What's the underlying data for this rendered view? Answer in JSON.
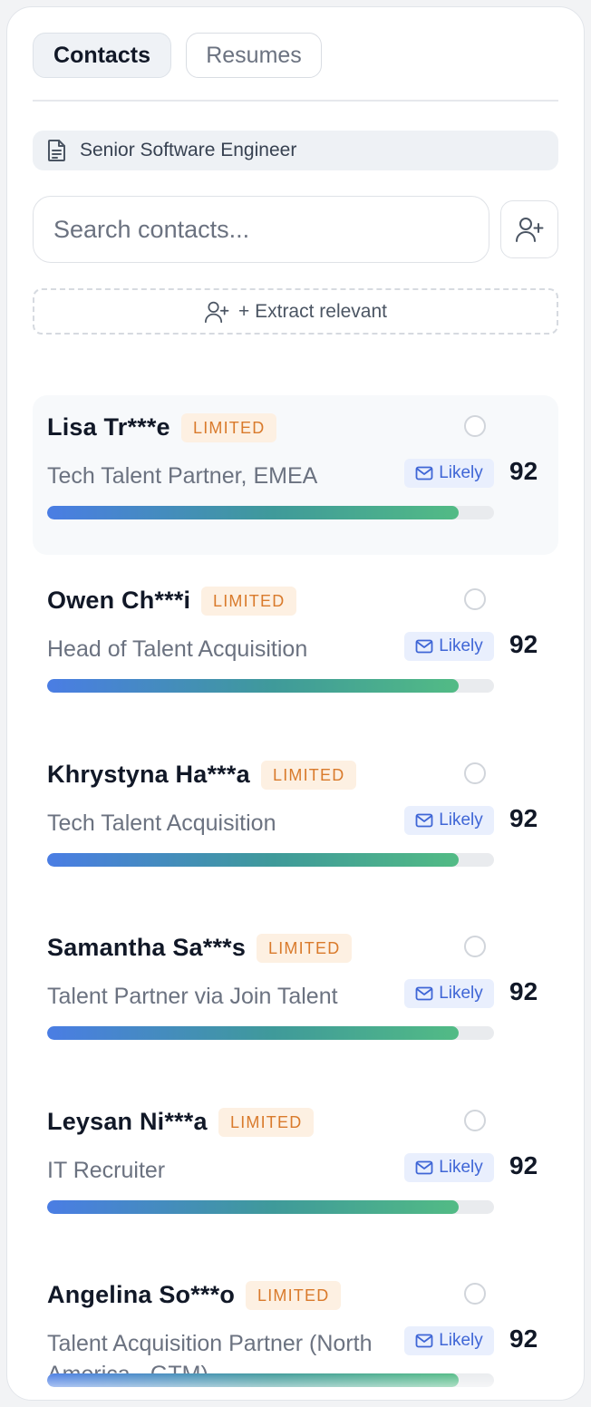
{
  "tabs": {
    "contacts": "Contacts",
    "resumes": "Resumes"
  },
  "job": {
    "title": "Senior Software Engineer",
    "icon": "document-icon"
  },
  "search": {
    "placeholder": "Search contacts..."
  },
  "add_contact_icon": "user-plus-icon",
  "extract": {
    "label": "+ Extract relevant",
    "icon": "user-plus-icon"
  },
  "colors": {
    "badge_text": "#d97a2b",
    "badge_bg": "#fdf0e2",
    "likely_text": "#3f66d6",
    "likely_bg": "#e9effd",
    "bar_start": "#4a7de4",
    "bar_end": "#52bb85"
  },
  "contacts": [
    {
      "name": "Lisa Tr***e",
      "badge": "LIMITED",
      "role": "Tech Talent Partner, EMEA",
      "email_status": "Likely",
      "score": "92",
      "match_fraction": 0.92,
      "highlighted": true
    },
    {
      "name": "Owen Ch***i",
      "badge": "LIMITED",
      "role": "Head of Talent Acquisition",
      "email_status": "Likely",
      "score": "92",
      "match_fraction": 0.92
    },
    {
      "name": "Khrystyna Ha***a",
      "badge": "LIMITED",
      "role": "Tech Talent Acquisition",
      "email_status": "Likely",
      "score": "92",
      "match_fraction": 0.92
    },
    {
      "name": "Samantha Sa***s",
      "badge": "LIMITED",
      "role": "Talent Partner via Join Talent",
      "email_status": "Likely",
      "score": "92",
      "match_fraction": 0.92
    },
    {
      "name": "Leysan Ni***a",
      "badge": "LIMITED",
      "role": "IT Recruiter",
      "email_status": "Likely",
      "score": "92",
      "match_fraction": 0.92
    },
    {
      "name": "Angelina So***o",
      "badge": "LIMITED",
      "role": "Talent Acquisition Partner (North America - GTM)",
      "email_status": "Likely",
      "score": "92",
      "match_fraction": 0.92
    }
  ]
}
